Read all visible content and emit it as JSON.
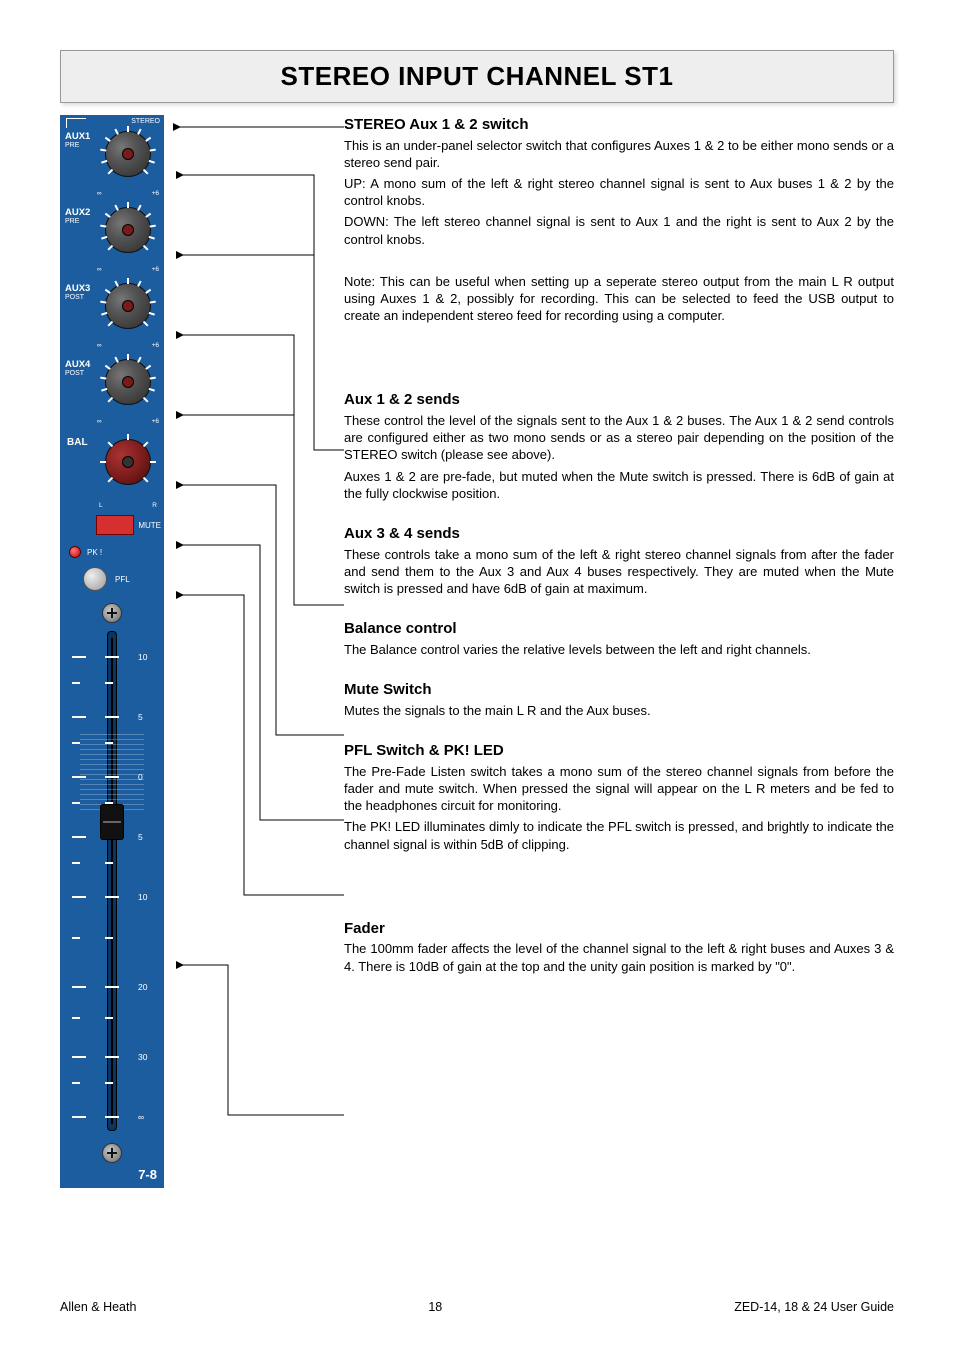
{
  "title": "STEREO INPUT CHANNEL ST1",
  "channel_strip": {
    "stereo_label": "STEREO",
    "auxes": [
      {
        "label": "AUX1",
        "sublabel": "PRE",
        "min": "∞",
        "max": "+6"
      },
      {
        "label": "AUX2",
        "sublabel": "PRE",
        "min": "∞",
        "max": "+6"
      },
      {
        "label": "AUX3",
        "sublabel": "POST",
        "min": "∞",
        "max": "+6"
      },
      {
        "label": "AUX4",
        "sublabel": "POST",
        "min": "∞",
        "max": "+6"
      }
    ],
    "balance": {
      "label": "BAL",
      "left": "L",
      "right": "R"
    },
    "mute_label": "MUTE",
    "pk_label": "PK !",
    "pfl_label": "PFL",
    "fader_scale": [
      "10",
      "5",
      "0",
      "5",
      "10",
      "20",
      "30",
      "∞"
    ],
    "channel_label": "7-8"
  },
  "sections": [
    {
      "heading": "STEREO Aux 1 & 2 switch",
      "paragraphs": [
        "This is an under-panel selector switch that configures Auxes 1 & 2 to be either mono sends or a stereo send pair.",
        "UP: A mono sum of the left & right stereo channel signal is sent to Aux buses 1 & 2 by the control knobs.",
        "DOWN: The left stereo channel signal is sent to Aux 1 and the right is sent to Aux 2 by the control knobs.",
        "Note: This can be useful when setting up a seperate stereo output from the main L R output using Auxes 1 & 2, possibly for recording. This can be selected to feed the USB output to create an independent stereo feed for recording using a computer."
      ]
    },
    {
      "heading": "Aux 1 & 2 sends",
      "paragraphs": [
        "These control the level of the signals sent to the Aux 1 & 2 buses. The Aux 1 & 2 send controls are configured either as two mono sends or as a stereo pair depending on the position of the STEREO switch (please see above).",
        "Auxes 1 & 2 are pre-fade, but muted when the Mute switch is pressed. There is 6dB of gain at the fully clockwise position."
      ]
    },
    {
      "heading": "Aux 3 & 4 sends",
      "paragraphs": [
        "These controls take a mono sum of the left & right stereo channel signals from after the fader and send them to the Aux 3 and Aux 4 buses respectively. They are muted when the Mute switch is pressed and have 6dB of gain at maximum."
      ]
    },
    {
      "heading": "Balance control",
      "paragraphs": [
        "The Balance control varies the relative levels between the left and right channels."
      ]
    },
    {
      "heading": "Mute Switch",
      "paragraphs": [
        "Mutes the signals to the main L R and the Aux buses."
      ]
    },
    {
      "heading": "PFL Switch & PK! LED",
      "paragraphs": [
        "The Pre-Fade Listen switch takes a mono sum of the stereo channel signals from before the fader and mute switch. When pressed the signal will appear on the L R meters and be fed to the headphones circuit for monitoring.",
        "The PK! LED illuminates dimly to indicate the PFL switch is pressed, and brightly to indicate the channel signal is within 5dB of clipping."
      ]
    },
    {
      "heading": "Fader",
      "paragraphs": [
        "The 100mm fader affects the level of the channel signal to the left & right buses and Auxes 3 & 4.  There is 10dB of gain at the top and the unity gain position is marked by \"0\"."
      ]
    }
  ],
  "footer": {
    "left": "Allen & Heath",
    "center": "18",
    "right": "ZED-14, 18 & 24 User Guide"
  }
}
